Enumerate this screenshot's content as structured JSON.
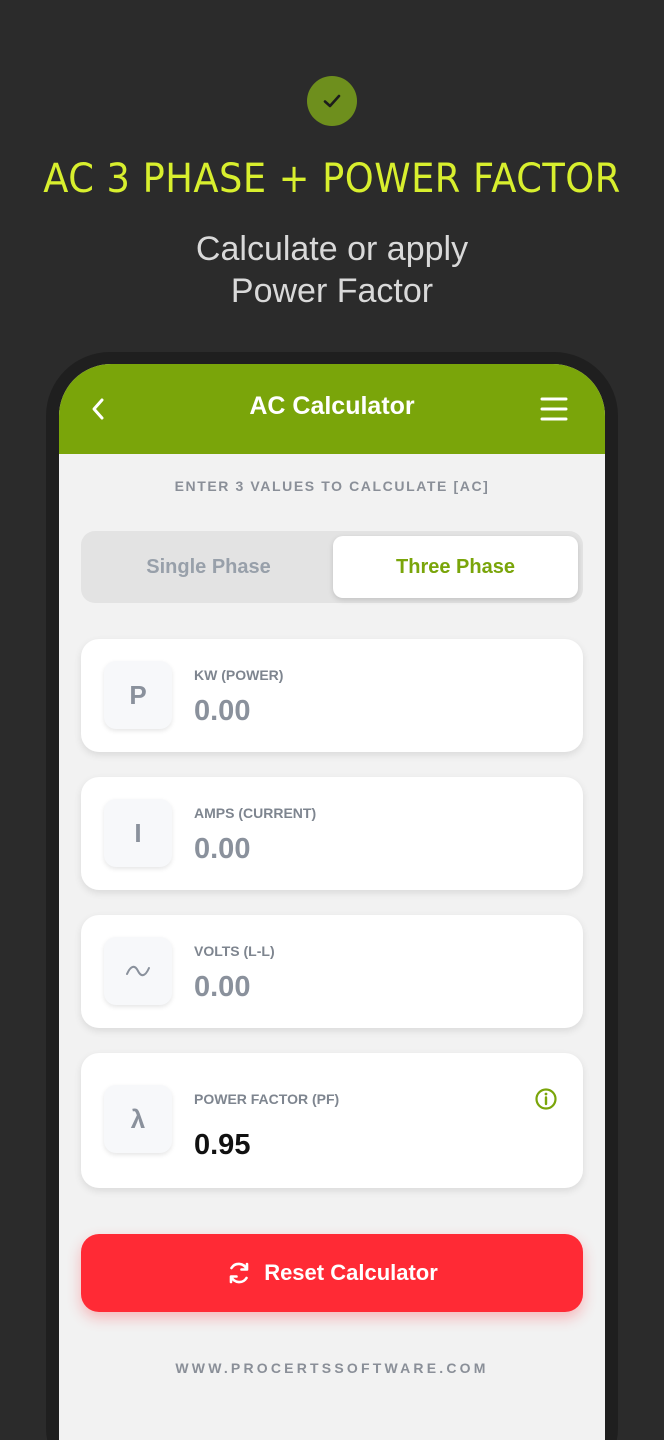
{
  "promo": {
    "headline": "AC 3 PHASE + POWER FACTOR",
    "subline_1": "Calculate or apply",
    "subline_2": "Power Factor"
  },
  "appbar": {
    "title": "AC Calculator"
  },
  "instruction": "ENTER 3 VALUES TO CALCULATE [AC]",
  "phase_toggle": {
    "options": [
      "Single Phase",
      "Three Phase"
    ],
    "selected": "Three Phase"
  },
  "fields": [
    {
      "symbol": "P",
      "label": "KW (POWER)",
      "value": "0.00"
    },
    {
      "symbol": "I",
      "label": "AMPS (CURRENT)",
      "value": "0.00"
    },
    {
      "symbol": "~",
      "label": "VOLTS (L-L)",
      "value": "0.00"
    },
    {
      "symbol": "λ",
      "label": "POWER FACTOR (PF)",
      "value": "0.95"
    }
  ],
  "reset_label": "Reset Calculator",
  "website": "WWW.PROCERTSSOFTWARE.COM",
  "colors": {
    "brand_green": "#7aa50a",
    "headline_yellow": "#d8ef2e",
    "reset_red": "#ff2a35"
  },
  "icons": [
    "check-icon",
    "back-arrow-icon",
    "hamburger-menu-icon",
    "info-icon",
    "refresh-icon"
  ]
}
